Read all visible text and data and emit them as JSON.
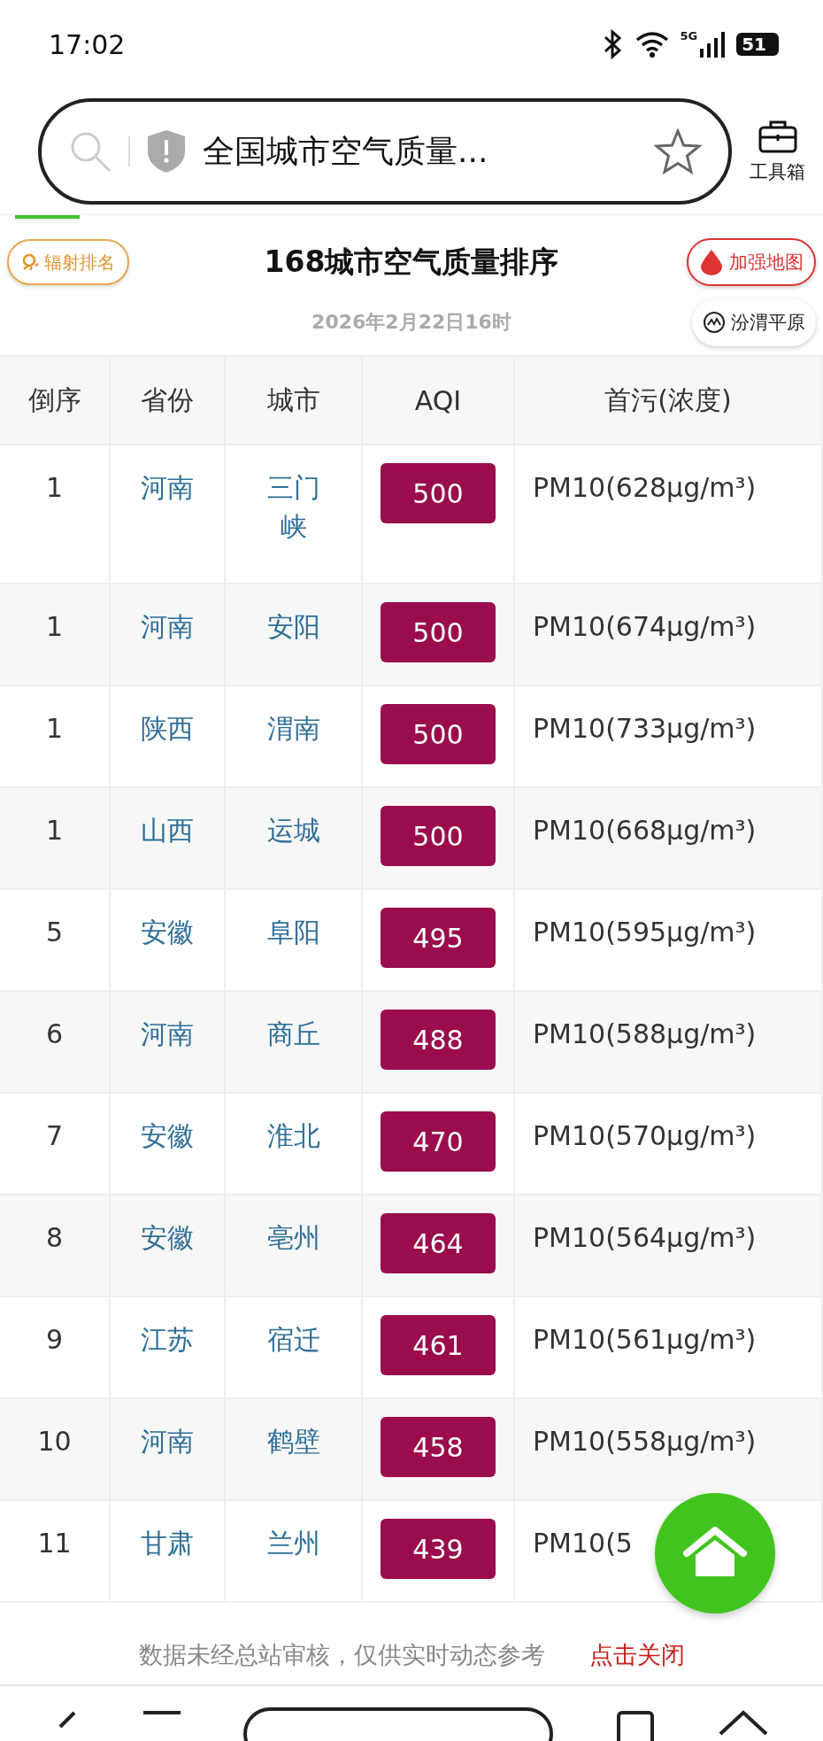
{
  "status_bar": {
    "time": "17:02",
    "network": "5G",
    "battery": "51"
  },
  "browser": {
    "address": "全国城市空气质量...",
    "toolbox_label": "工具箱"
  },
  "header": {
    "left_button": "辐射排名",
    "title": "168城市空气质量排序",
    "date": "2026年2月22日16时",
    "right_buttons": [
      {
        "label": "加强地图",
        "kind": "map"
      },
      {
        "label": "汾渭平原",
        "kind": "region"
      }
    ]
  },
  "table": {
    "columns": [
      "倒序",
      "省份",
      "城市",
      "AQI",
      "首污(浓度)"
    ],
    "rows": [
      {
        "rank": "1",
        "province": "河南",
        "city": "三门峡",
        "aqi": "500",
        "pollutant": "PM10(628μg/m³)"
      },
      {
        "rank": "1",
        "province": "河南",
        "city": "安阳",
        "aqi": "500",
        "pollutant": "PM10(674μg/m³)"
      },
      {
        "rank": "1",
        "province": "陕西",
        "city": "渭南",
        "aqi": "500",
        "pollutant": "PM10(733μg/m³)"
      },
      {
        "rank": "1",
        "province": "山西",
        "city": "运城",
        "aqi": "500",
        "pollutant": "PM10(668μg/m³)"
      },
      {
        "rank": "5",
        "province": "安徽",
        "city": "阜阳",
        "aqi": "495",
        "pollutant": "PM10(595μg/m³)"
      },
      {
        "rank": "6",
        "province": "河南",
        "city": "商丘",
        "aqi": "488",
        "pollutant": "PM10(588μg/m³)"
      },
      {
        "rank": "7",
        "province": "安徽",
        "city": "淮北",
        "aqi": "470",
        "pollutant": "PM10(570μg/m³)"
      },
      {
        "rank": "8",
        "province": "安徽",
        "city": "亳州",
        "aqi": "464",
        "pollutant": "PM10(564μg/m³)"
      },
      {
        "rank": "9",
        "province": "江苏",
        "city": "宿迁",
        "aqi": "461",
        "pollutant": "PM10(561μg/m³)"
      },
      {
        "rank": "10",
        "province": "河南",
        "city": "鹤壁",
        "aqi": "458",
        "pollutant": "PM10(558μg/m³)"
      },
      {
        "rank": "11",
        "province": "甘肃",
        "city": "兰州",
        "aqi": "439",
        "pollutant": "PM10(5"
      }
    ]
  },
  "notice": {
    "text": "数据未经总站审核，仅供实时动态参考",
    "close": "点击关闭"
  }
}
